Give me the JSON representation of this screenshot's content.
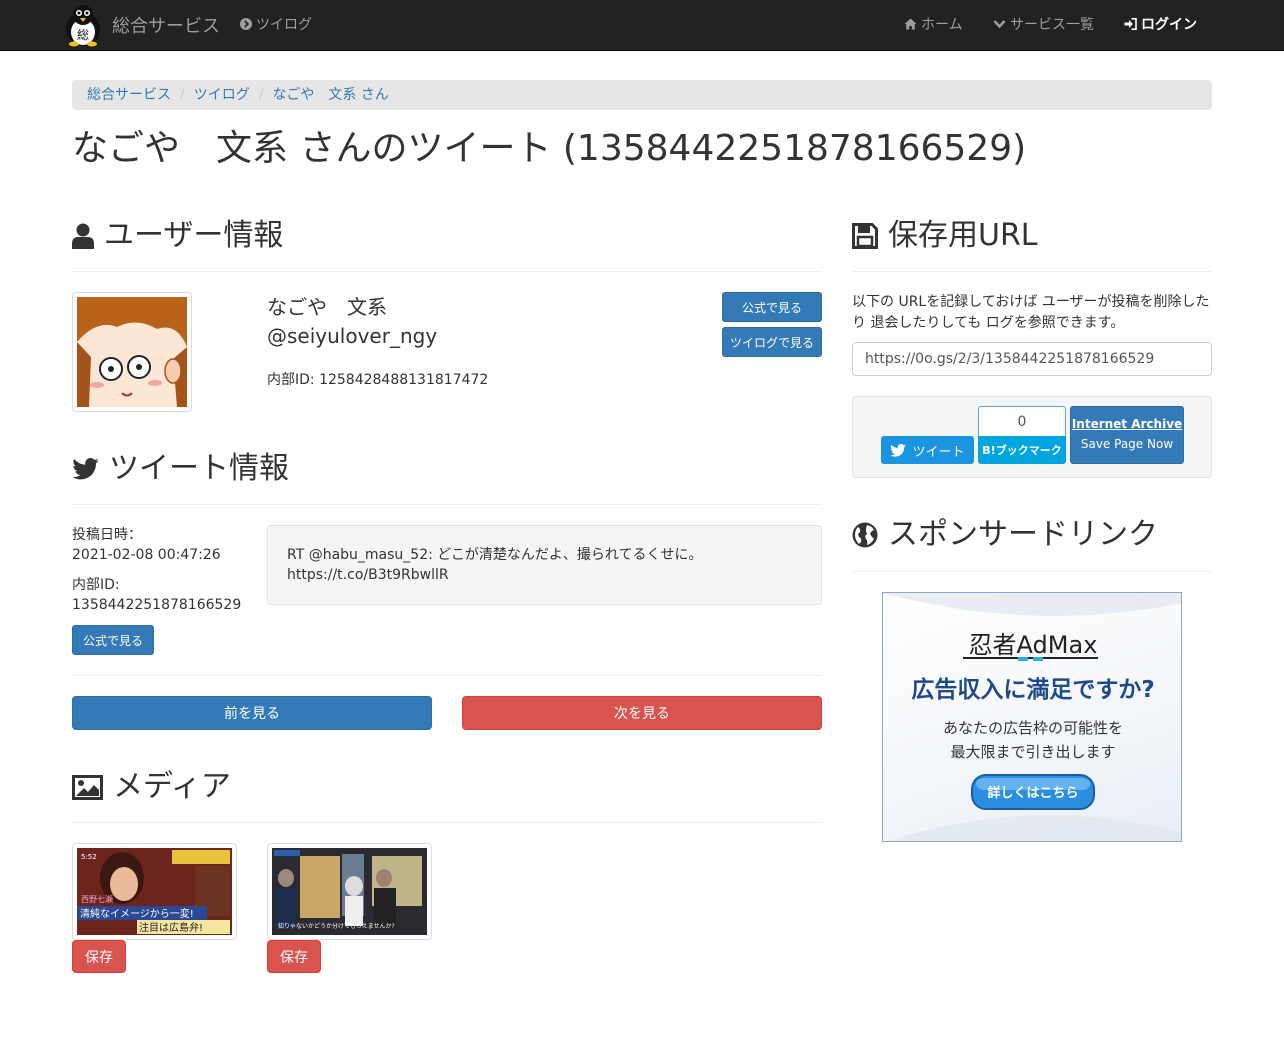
{
  "navbar": {
    "brand": "総合サービス",
    "logo_text": "総",
    "tsuilog": "ツイログ",
    "home": "ホーム",
    "services": "サービス一覧",
    "login": "ログイン"
  },
  "breadcrumb": [
    "総合サービス",
    "ツイログ",
    "なごや　文系 さん"
  ],
  "page_title": "なごや　文系 さんのツイート (1358442251878166529)",
  "user_section": {
    "heading": "ユーザー情報",
    "display_name": "なごや　文系",
    "screen_name": "@seiyulover_ngy",
    "internal_id": "内部ID: 1258428488131817472",
    "official_button": "公式で見る",
    "tsuilog_button": "ツイログで見る"
  },
  "tweet_section": {
    "heading": "ツイート情報",
    "posted_label": "投稿日時：",
    "posted_value": "2021-02-08 00:47:26",
    "id_label": "内部ID:",
    "id_value": "1358442251878166529",
    "official_button": "公式で見る",
    "text_line1": "RT @habu_masu_52: どこが清楚なんだよ、撮られてるくせに。",
    "text_line2": "https://t.co/B3t9RbwllR"
  },
  "pager": {
    "prev": "前を見る",
    "next": "次を見る"
  },
  "media_section": {
    "heading": "メディア",
    "save_button": "保存",
    "items": [
      {
        "caption_name": "西野七瀬",
        "caption_line1": "清純なイメージから一変!",
        "caption_line2": "注目は広島弁!",
        "time": "5:52"
      },
      {
        "caption_line1": "知りゃないかどうか分けてもらえませんか?"
      }
    ]
  },
  "save_url_section": {
    "heading": "保存用URL",
    "description_line1": "以下の URLを記録しておけば ユーザーが投稿を削除した",
    "description_line2": "り 退会したりしても ログを参照できます。",
    "url": "https://0o.gs/2/3/1358442251878166529",
    "tweet_button": "ツイート",
    "hatena_count": "0",
    "hatena_button": "B!ブックマーク",
    "ia_title": "Internet Archive",
    "ia_sub": "Save Page Now"
  },
  "sponsor_section": {
    "heading": "スポンサードリンク",
    "ad_logo": "忍者AdMax",
    "ad_headline": "広告収入に満足ですか?",
    "ad_line1": "あなたの広告枠の可能性を",
    "ad_line2": "最大限まで引き出します",
    "ad_button": "詳しくはこちら"
  },
  "colors": {
    "navbar": "#222222",
    "primary": "#337ab7",
    "danger": "#d9534f",
    "twitter": "#1b95e0",
    "hatena": "#00a4de"
  }
}
